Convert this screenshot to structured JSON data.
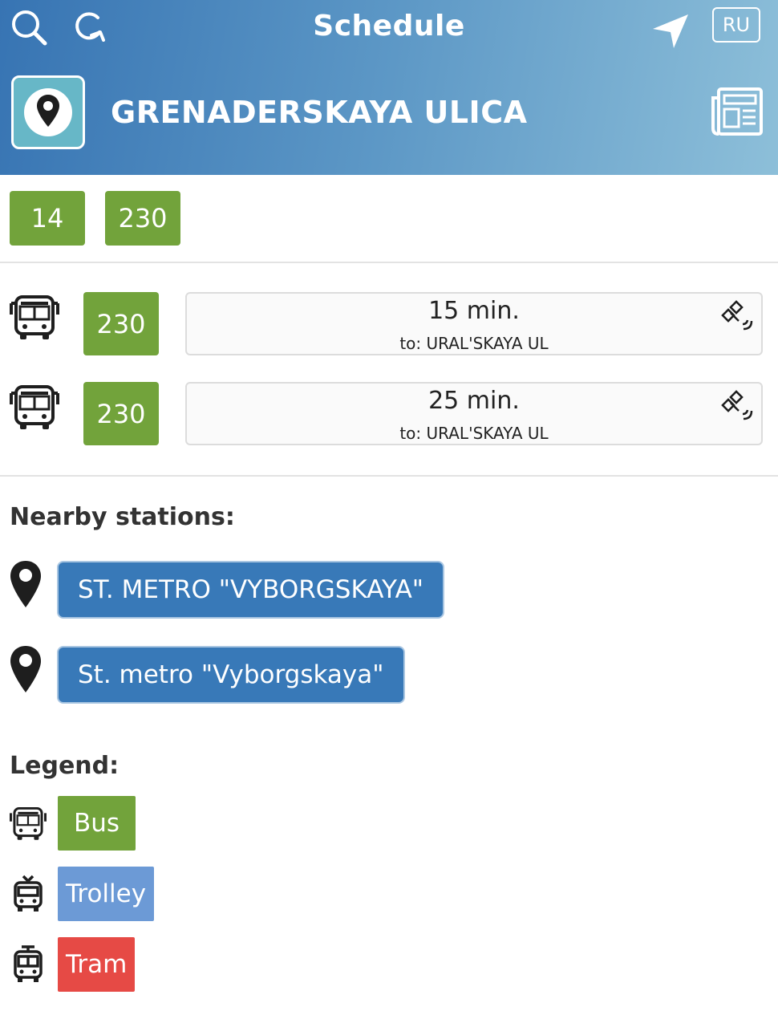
{
  "header": {
    "title": "Schedule",
    "language_button": "RU",
    "stop_name": "GRENADERSKAYA ULICA",
    "icons": [
      "search-icon",
      "refresh-icon",
      "location-arrow-icon",
      "news-icon",
      "map-pin-icon"
    ]
  },
  "routes": [
    "14",
    "230"
  ],
  "arrivals": [
    {
      "vehicle": "bus",
      "route": "230",
      "time": "15 min.",
      "destination": "to: URAL'SKAYA UL",
      "realtime_icon": "satellite-icon"
    },
    {
      "vehicle": "bus",
      "route": "230",
      "time": "25 min.",
      "destination": "to: URAL'SKAYA UL",
      "realtime_icon": "satellite-icon"
    }
  ],
  "nearby": {
    "heading": "Nearby stations:",
    "stations": [
      "ST. METRO \"VYBORGSKAYA\"",
      "St. metro \"Vyborgskaya\""
    ]
  },
  "legend": {
    "heading": "Legend:",
    "items": [
      {
        "label": "Bus",
        "color": "#72a33b",
        "icon": "bus-icon"
      },
      {
        "label": "Trolley",
        "color": "#6c9ad6",
        "icon": "trolley-icon"
      },
      {
        "label": "Tram",
        "color": "#e64a45",
        "icon": "tram-icon"
      }
    ]
  },
  "colors": {
    "header_start": "#3774b3",
    "header_end": "#8dbfd9",
    "route_chip": "#72a33b",
    "station_button": "#3879b8"
  }
}
